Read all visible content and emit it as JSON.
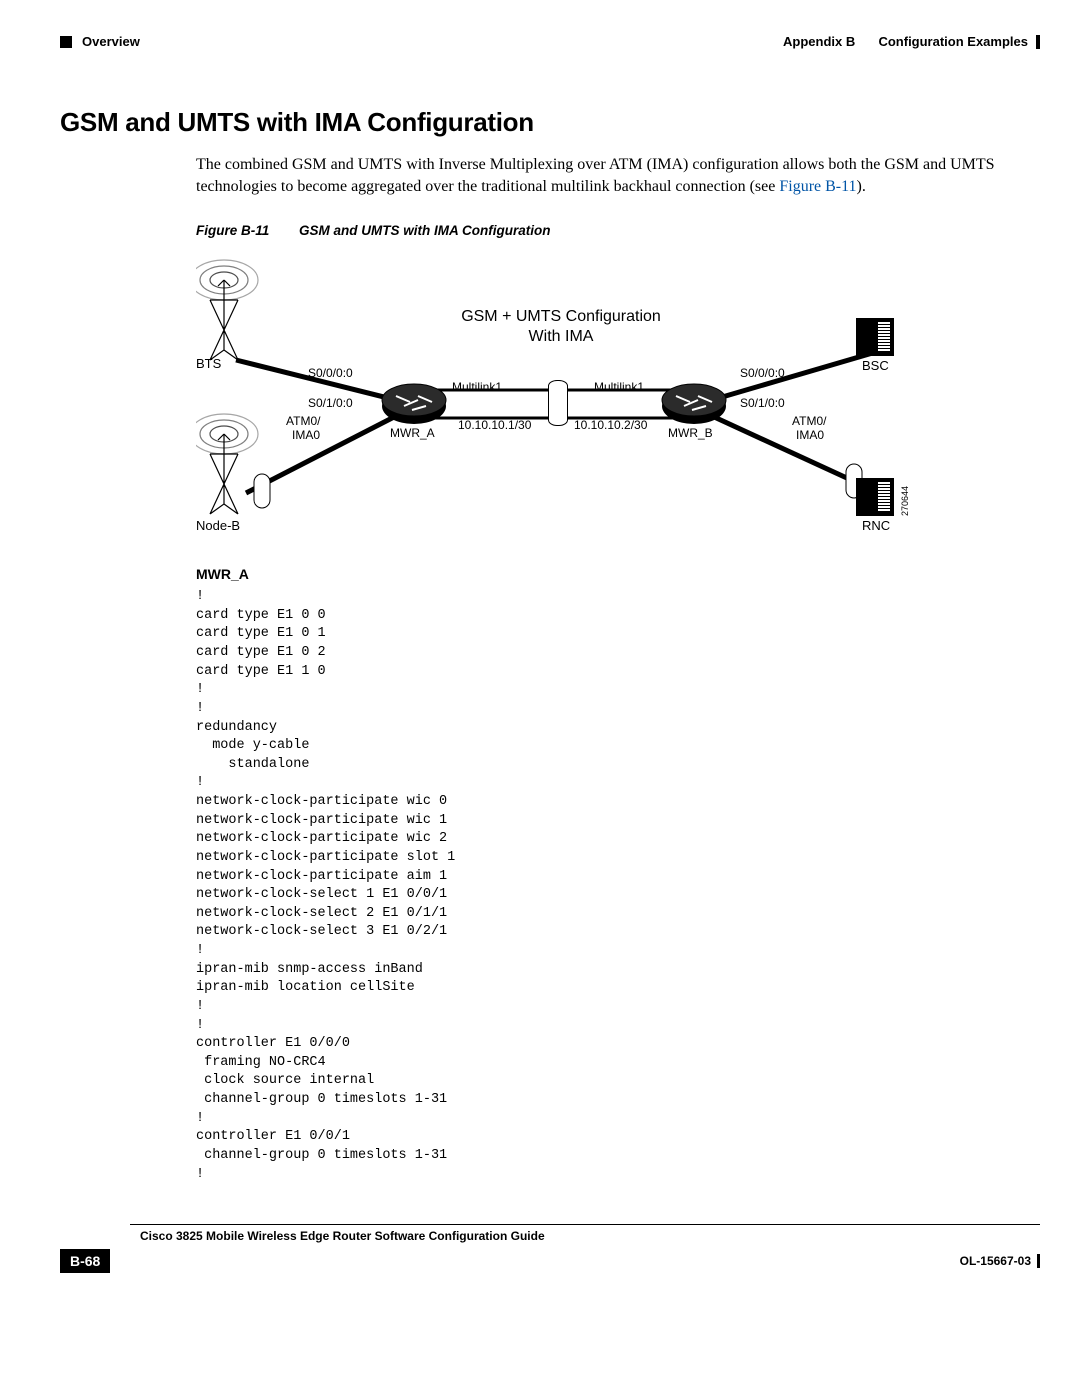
{
  "header": {
    "section": "Overview",
    "appendix": "Appendix B",
    "appendix_title": "Configuration Examples"
  },
  "title": "GSM and UMTS with IMA Configuration",
  "paragraph": {
    "t1": "The combined GSM and UMTS with Inverse Multiplexing over ATM (IMA) configuration allows both the GSM and UMTS technologies to become aggregated over the traditional multilink backhaul connection (see ",
    "figref": "Figure B-11",
    "t2": ")."
  },
  "figure": {
    "number": "Figure B-11",
    "caption": "GSM and UMTS with IMA Configuration"
  },
  "diagram": {
    "title1": "GSM + UMTS Configuration",
    "title2": "With IMA",
    "bts": "BTS",
    "nodeb": "Node-B",
    "bsc": "BSC",
    "rnc": "RNC",
    "s0000_l": "S0/0/0:0",
    "s0100_l": "S0/1/0:0",
    "atm0_l1": "ATM0/",
    "ima0_l1": "IMA0",
    "mwra": "MWR_A",
    "ml1_l": "Multilink1",
    "ip_l": "10.10.10.1/30",
    "ip_r": "10.10.10.2/30",
    "ml1_r": "Multilink1",
    "mwrb": "MWR_B",
    "s0000_r": "S0/0/0:0",
    "s0100_r": "S0/1/0:0",
    "atm0_r1": "ATM0/",
    "ima0_r1": "IMA0",
    "sidecode": "270644"
  },
  "code_heading": "MWR_A",
  "code": "!\ncard type E1 0 0\ncard type E1 0 1\ncard type E1 0 2\ncard type E1 1 0\n!\n!\nredundancy\n  mode y-cable\n    standalone\n!\nnetwork-clock-participate wic 0\nnetwork-clock-participate wic 1\nnetwork-clock-participate wic 2\nnetwork-clock-participate slot 1\nnetwork-clock-participate aim 1\nnetwork-clock-select 1 E1 0/0/1\nnetwork-clock-select 2 E1 0/1/1\nnetwork-clock-select 3 E1 0/2/1\n!\nipran-mib snmp-access inBand\nipran-mib location cellSite\n!\n!\ncontroller E1 0/0/0\n framing NO-CRC4\n clock source internal\n channel-group 0 timeslots 1-31\n!\ncontroller E1 0/0/1\n channel-group 0 timeslots 1-31\n!",
  "footer": {
    "guide": "Cisco 3825 Mobile Wireless Edge Router Software Configuration Guide",
    "page": "B-68",
    "docnum": "OL-15667-03"
  }
}
